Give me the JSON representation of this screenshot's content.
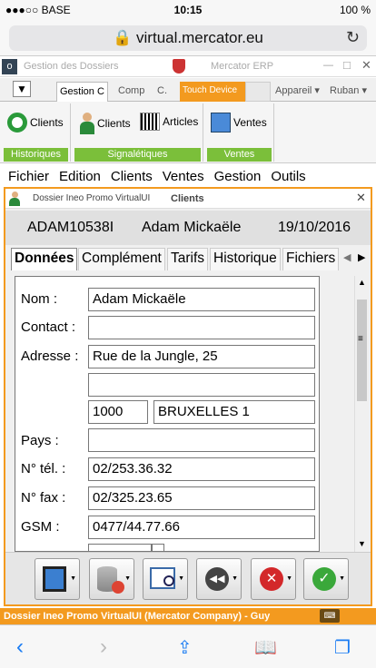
{
  "status": {
    "carrier": "●●●○○ BASE",
    "time": "10:15",
    "battery": "100 %"
  },
  "browser": {
    "url": "virtual.mercator.eu"
  },
  "app": {
    "left_title": "Gestion des Dossiers",
    "right_title": "Mercator ERP"
  },
  "ribbon_tabs": [
    "Gestion C",
    "Comp",
    "C.",
    "Touch Device",
    "Appareil",
    "Ruban"
  ],
  "ribbon": {
    "groups": [
      {
        "label": "Historiques",
        "buttons": [
          "Clients"
        ]
      },
      {
        "label": "Signalétiques",
        "buttons": [
          "Clients",
          "Articles"
        ]
      },
      {
        "label": "Ventes",
        "buttons": [
          "Ventes"
        ]
      }
    ]
  },
  "menu": [
    "Fichier",
    "Edition",
    "Clients",
    "Ventes",
    "Gestion",
    "Outils"
  ],
  "window": {
    "title_left": "Dossier Ineo Promo VirtualUI",
    "title_center": "Clients",
    "code": "ADAM10538I",
    "name": "Adam Mickaële",
    "date": "19/10/2016",
    "tabs": [
      "Données",
      "Complément",
      "Tarifs",
      "Historique",
      "Fichiers"
    ],
    "fields": {
      "nom_label": "Nom :",
      "nom": "Adam Mickaële",
      "contact_label": "Contact :",
      "contact": "",
      "adresse_label": "Adresse :",
      "adresse1": "Rue de la Jungle, 25",
      "adresse2": "",
      "cp": "1000",
      "ville": "BRUXELLES 1",
      "pays_label": "Pays :",
      "pays": "",
      "tel_label": "N° tél. :",
      "tel": "02/253.36.32",
      "fax_label": "N° fax :",
      "fax": "02/325.23.65",
      "gsm_label": "GSM :",
      "gsm": "0477/44.77.66"
    }
  },
  "footer": "Dossier Ineo Promo VirtualUI (Mercator Company) - Guy",
  "colors": {
    "accent": "#f39a1f",
    "ribbon_green": "#7bbf3a",
    "ios_blue": "#1a7cf3"
  }
}
